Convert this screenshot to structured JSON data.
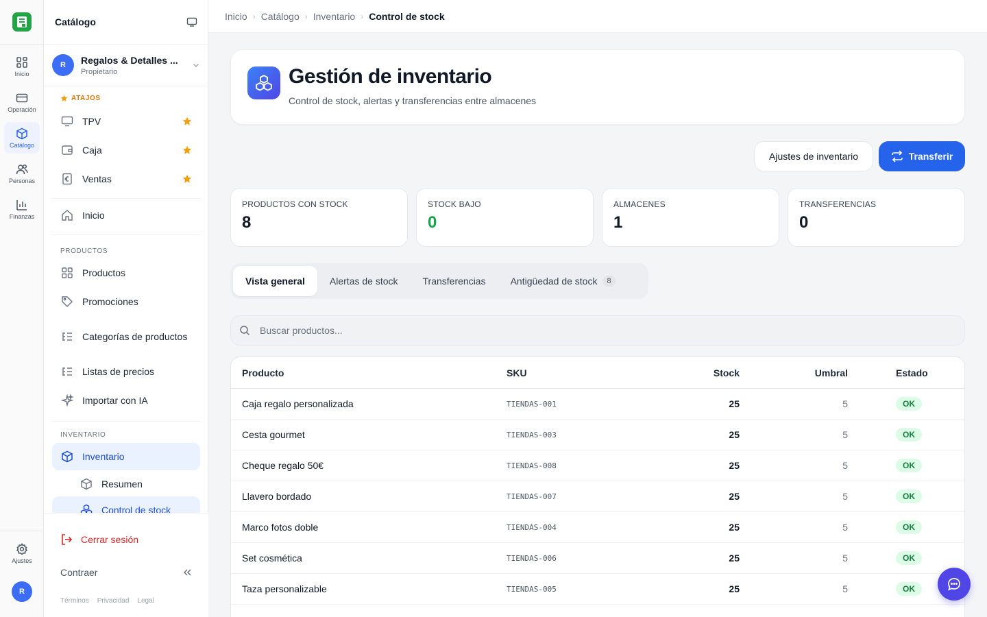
{
  "rail": {
    "items": [
      {
        "label": "Inicio",
        "icon": "grid-icon"
      },
      {
        "label": "Operación",
        "icon": "card-icon"
      },
      {
        "label": "Catálogo",
        "icon": "box-icon"
      },
      {
        "label": "Personas",
        "icon": "users-icon"
      },
      {
        "label": "Finanzas",
        "icon": "chart-icon"
      }
    ],
    "settings_label": "Ajustes",
    "avatar_initial": "R"
  },
  "sidebar": {
    "title": "Catálogo",
    "org": {
      "initial": "R",
      "name": "Regalos & Detalles ...",
      "role": "Propietario"
    },
    "shortcuts_label": "ATAJOS",
    "shortcuts": [
      {
        "label": "TPV",
        "icon": "monitor-icon"
      },
      {
        "label": "Caja",
        "icon": "wallet-icon"
      },
      {
        "label": "Ventas",
        "icon": "receipt-euro-icon"
      }
    ],
    "home_label": "Inicio",
    "products_section": "PRODUCTOS",
    "products_items": [
      {
        "label": "Productos",
        "icon": "grid-icon"
      },
      {
        "label": "Promociones",
        "icon": "tag-icon"
      },
      {
        "label": "Categorías de productos",
        "icon": "list-tree-icon"
      },
      {
        "label": "Listas de precios",
        "icon": "list-tree-icon"
      },
      {
        "label": "Importar con IA",
        "icon": "sparkles-icon"
      }
    ],
    "inventory_section": "INVENTARIO",
    "inventory_item": "Inventario",
    "inventory_sub": [
      "Resumen",
      "Control de stock"
    ],
    "logout_label": "Cerrar sesión",
    "collapse_label": "Contraer",
    "footer_links": [
      "Términos",
      "Privacidad",
      "Legal"
    ]
  },
  "breadcrumb": {
    "items": [
      "Inicio",
      "Catálogo",
      "Inventario"
    ],
    "current": "Control de stock"
  },
  "hero": {
    "title": "Gestión de inventario",
    "subtitle": "Control de stock, alertas y transferencias entre almacenes"
  },
  "actions": {
    "settings_label": "Ajustes de inventario",
    "transfer_label": "Transferir"
  },
  "stats": [
    {
      "label": "PRODUCTOS CON STOCK",
      "value": "8"
    },
    {
      "label": "STOCK BAJO",
      "value": "0"
    },
    {
      "label": "ALMACENES",
      "value": "1"
    },
    {
      "label": "TRANSFERENCIAS",
      "value": "0"
    }
  ],
  "tabs": [
    {
      "label": "Vista general"
    },
    {
      "label": "Alertas de stock"
    },
    {
      "label": "Transferencias"
    },
    {
      "label": "Antigüedad de stock",
      "badge": "8"
    }
  ],
  "search": {
    "placeholder": "Buscar productos..."
  },
  "table": {
    "columns": [
      "Producto",
      "SKU",
      "Stock",
      "Umbral",
      "Estado"
    ],
    "rows": [
      {
        "product": "Caja regalo personalizada",
        "sku": "TIENDAS-001",
        "stock": "25",
        "threshold": "5",
        "status": "OK"
      },
      {
        "product": "Cesta gourmet",
        "sku": "TIENDAS-003",
        "stock": "25",
        "threshold": "5",
        "status": "OK"
      },
      {
        "product": "Cheque regalo 50€",
        "sku": "TIENDAS-008",
        "stock": "25",
        "threshold": "5",
        "status": "OK"
      },
      {
        "product": "Llavero bordado",
        "sku": "TIENDAS-007",
        "stock": "25",
        "threshold": "5",
        "status": "OK"
      },
      {
        "product": "Marco fotos doble",
        "sku": "TIENDAS-004",
        "stock": "25",
        "threshold": "5",
        "status": "OK"
      },
      {
        "product": "Set cosmética",
        "sku": "TIENDAS-006",
        "stock": "25",
        "threshold": "5",
        "status": "OK"
      },
      {
        "product": "Taza personalizable",
        "sku": "TIENDAS-005",
        "stock": "25",
        "threshold": "5",
        "status": "OK"
      }
    ]
  },
  "colors": {
    "accent": "#2563eb",
    "brand": "#22a447",
    "ok": "#16a34a",
    "danger": "#dc2626",
    "shortcut": "#f59e0b"
  }
}
